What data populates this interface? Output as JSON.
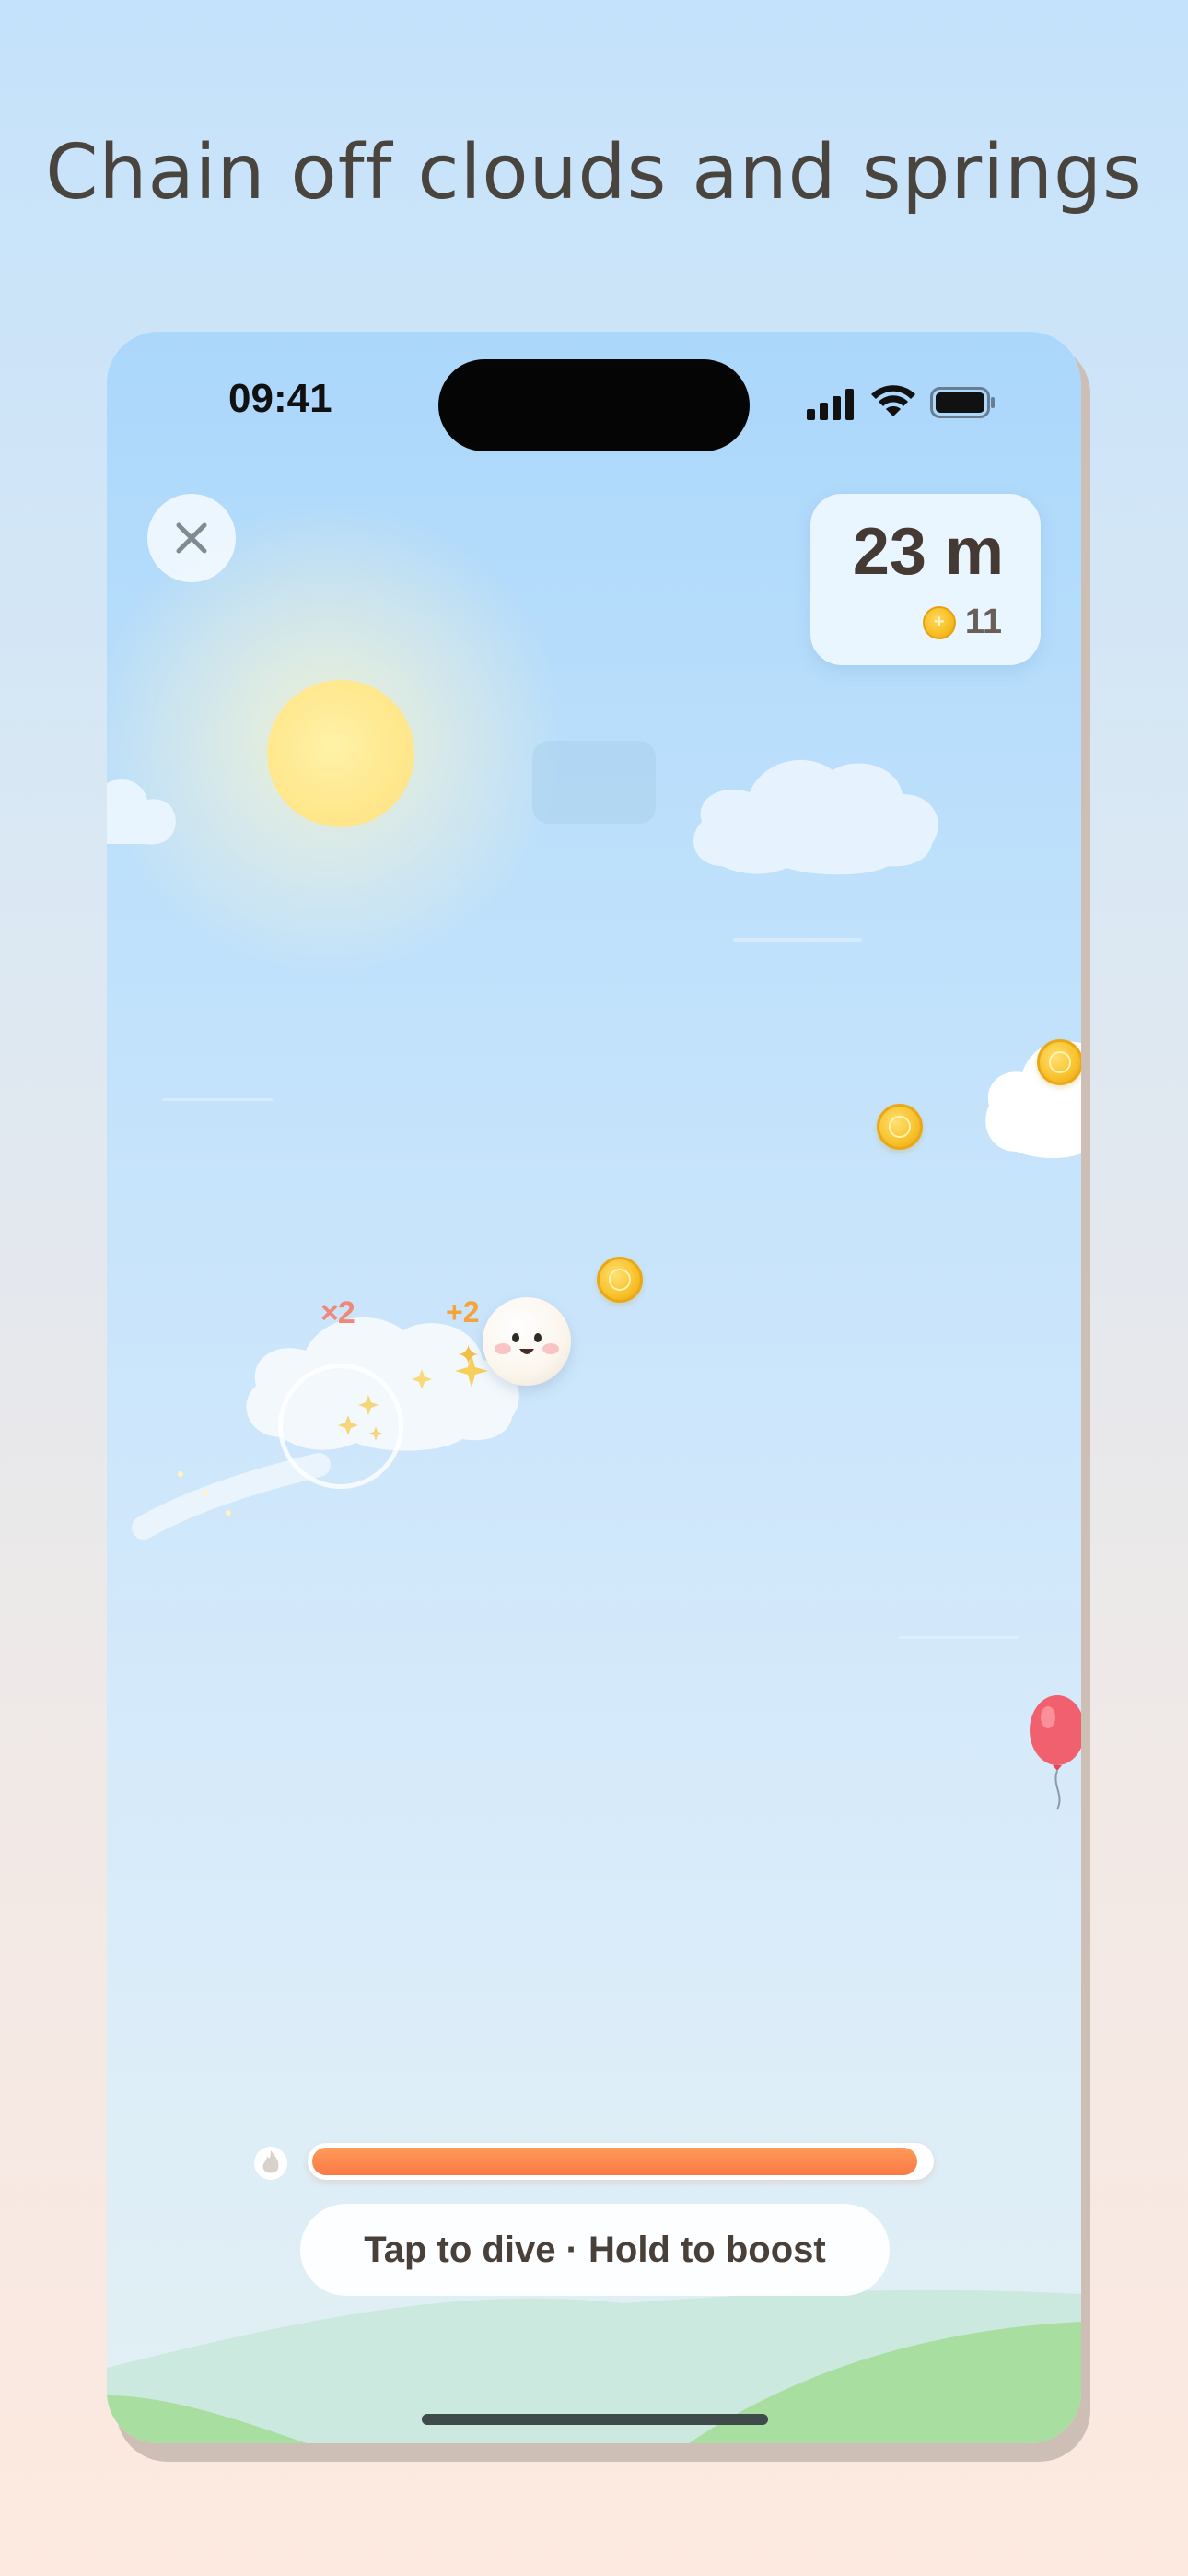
{
  "headline": "Chain off clouds and springs",
  "status_bar": {
    "time": "09:41",
    "icons": [
      "signal-bars-icon",
      "wifi-icon",
      "battery-icon"
    ]
  },
  "hud": {
    "close_icon": "close-icon",
    "distance": "23 m",
    "coins": "11"
  },
  "game": {
    "combo_label": "×2",
    "bonus_label": "+2",
    "boost_meter_level": 0.98,
    "hint": "Tap to dive · Hold to boost"
  },
  "colors": {
    "sky_top": "#abd7fb",
    "sky_bottom": "#e2f0f2",
    "coin": "#f8c12a",
    "boost": "#f97a45",
    "balloon": "#f0606e",
    "hills": "#a8dea0",
    "text_dark": "#453a33"
  }
}
